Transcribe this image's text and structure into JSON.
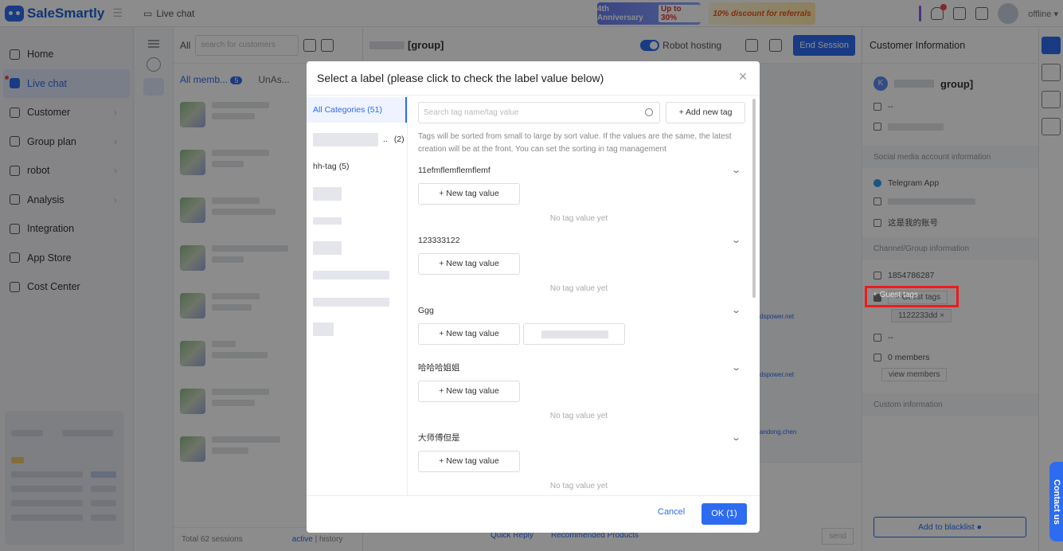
{
  "app": {
    "name": "SaleSmartly",
    "section": "Live chat"
  },
  "banners": {
    "anniversary": "4th Anniversary",
    "anniversary_pct": "Up to 30%",
    "discount": "10% discount for referrals"
  },
  "topbar": {
    "status": "offline"
  },
  "nav": {
    "items": [
      {
        "label": "Home",
        "chev": false
      },
      {
        "label": "Live chat",
        "chev": false,
        "active": true
      },
      {
        "label": "Customer",
        "chev": true
      },
      {
        "label": "Group plan",
        "chev": true
      },
      {
        "label": "robot",
        "chev": true
      },
      {
        "label": "Analysis",
        "chev": true
      },
      {
        "label": "Integration",
        "chev": false
      },
      {
        "label": "App Store",
        "chev": false
      },
      {
        "label": "Cost Center",
        "chev": false
      }
    ]
  },
  "convlist": {
    "filter_all": "All",
    "search_placeholder": "search for customers",
    "tab_members": "All memb...",
    "members_badge": "5",
    "tab_unassigned": "UnAs...",
    "total": "Total 62 sessions",
    "active": "active",
    "history": "history"
  },
  "chat": {
    "group_name": "[group]",
    "robot_hosting": "Robot hosting",
    "end_session": "End Session",
    "send": "send",
    "quick_reply": "Quick Reply",
    "recommended": "Recommended Products",
    "senders": [
      "dspower.net",
      "dspower.net",
      "andong.chen"
    ]
  },
  "rightpanel": {
    "title": "Customer Information",
    "name": "group]",
    "avatar_letter": "K",
    "dash": "--",
    "sec_social": "Social media account information",
    "telegram": "Telegram App",
    "my_account": "这是我的账号",
    "sec_channel": "Channel/Group information",
    "group_id": "1854786287",
    "guest_tags": "+ Guest tags",
    "tag_value": "1122233dd",
    "members": "0 members",
    "view_members": "view members",
    "sec_custom": "Custom information",
    "blacklist": "Add to blacklist",
    "contact_us": "Contact us"
  },
  "modal": {
    "title": "Select a label (please click to check the label value below)",
    "categories": [
      {
        "label": "All Categories (51)",
        "active": true
      },
      {
        "label": "(2)",
        "blur": true
      },
      {
        "label": "hh-tag (5)"
      }
    ],
    "search_placeholder": "Search tag name/tag value",
    "add_new_tag": "+ Add new tag",
    "sort_hint": "Tags will be sorted from small to large by sort value. If the values are the same, the latest creation will be at the front. You can set the sorting in tag management",
    "new_tag_value": "+ New tag value",
    "no_value": "No tag value yet",
    "groups": [
      {
        "name": "11efmflemflemflemf",
        "has_value": false
      },
      {
        "name": "123333122",
        "has_value": false
      },
      {
        "name": "Ggg",
        "has_value": true
      },
      {
        "name": "哈哈哈姐姐",
        "has_value": false
      },
      {
        "name": "大师傅但是",
        "has_value": false
      }
    ],
    "cancel": "Cancel",
    "ok": "OK (1)"
  },
  "colors": {
    "accent": "#2d6cf0",
    "highlight_box": "#ee1b1b"
  }
}
